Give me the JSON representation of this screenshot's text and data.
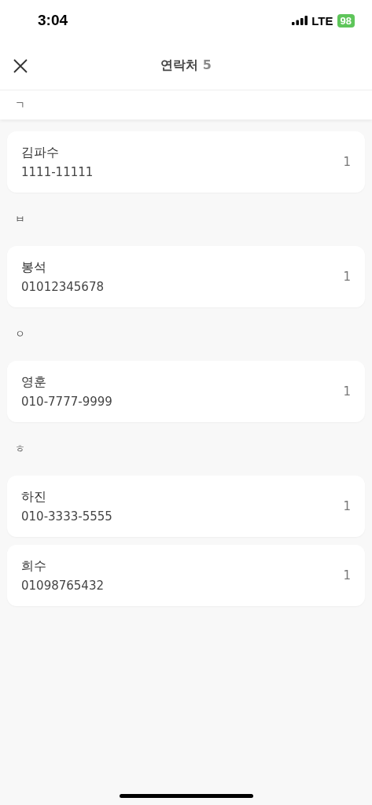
{
  "status_bar": {
    "time": "3:04",
    "network": "LTE",
    "battery": "98"
  },
  "header": {
    "title": "연락처",
    "count": "5"
  },
  "sections": [
    {
      "letter": "ㄱ",
      "pinned": true,
      "contacts": [
        {
          "name": "김파수",
          "phone": "1111-11111",
          "count": "1"
        }
      ]
    },
    {
      "letter": "ㅂ",
      "pinned": false,
      "contacts": [
        {
          "name": "봉석",
          "phone": "01012345678",
          "count": "1"
        }
      ]
    },
    {
      "letter": "ㅇ",
      "pinned": false,
      "contacts": [
        {
          "name": "영훈",
          "phone": "010-7777-9999",
          "count": "1"
        }
      ]
    },
    {
      "letter": "ㅎ",
      "pinned": false,
      "contacts": [
        {
          "name": "하진",
          "phone": "010-3333-5555",
          "count": "1"
        },
        {
          "name": "희수",
          "phone": "01098765432",
          "count": "1"
        }
      ]
    }
  ]
}
